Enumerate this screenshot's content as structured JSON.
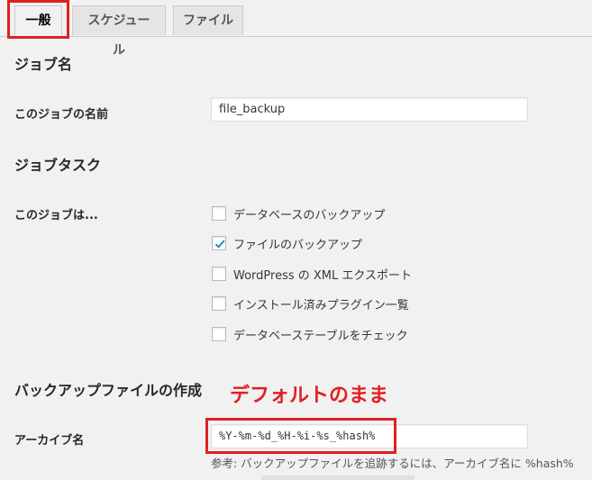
{
  "tabs": [
    {
      "label": "一般",
      "active": true
    },
    {
      "label": "スケジュール",
      "active": false
    },
    {
      "label": "ファイル",
      "active": false
    }
  ],
  "sections": {
    "job_name": {
      "heading": "ジョブ名",
      "label": "このジョブの名前",
      "value": "file_backup"
    },
    "job_tasks": {
      "heading": "ジョブタスク",
      "label": "このジョブは...",
      "options": [
        {
          "label": "データベースのバックアップ",
          "checked": false
        },
        {
          "label": "ファイルのバックアップ",
          "checked": true
        },
        {
          "label": "WordPress の XML エクスポート",
          "checked": false
        },
        {
          "label": "インストール済みプラグイン一覧",
          "checked": false
        },
        {
          "label": "データベーステーブルをチェック",
          "checked": false
        }
      ]
    },
    "backup_file": {
      "heading": "バックアップファイルの作成",
      "archive_label": "アーカイブ名",
      "archive_value": "%Y-%m-%d_%H-%i-%s_%hash%",
      "note": "参考: バックアップファイルを追跡するには、アーカイブ名に %hash%"
    }
  },
  "annotation": {
    "text": "デフォルトのまま",
    "color": "#e02020"
  },
  "colors": {
    "highlight_box": "#e02020",
    "checkmark": "#1e8cbe"
  }
}
